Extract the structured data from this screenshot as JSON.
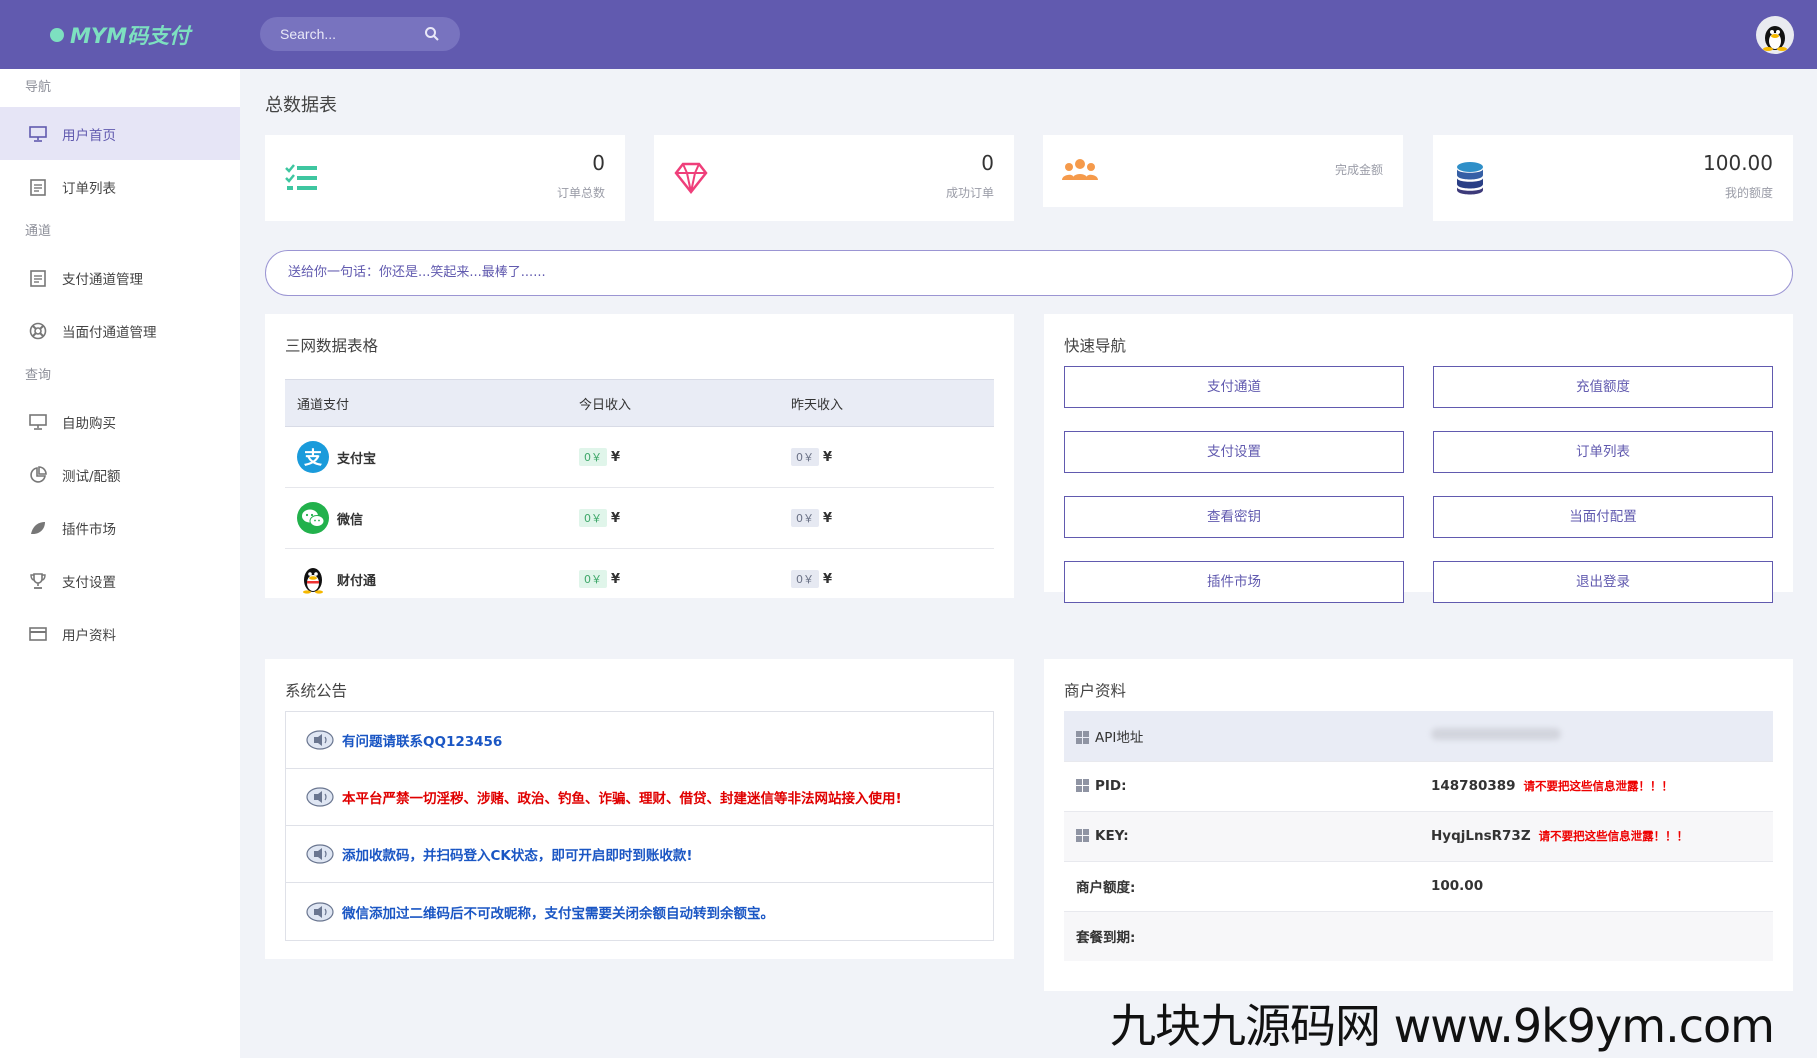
{
  "brand": {
    "name": "MYM码支付"
  },
  "search": {
    "placeholder": "Search..."
  },
  "sidebar": {
    "sections": [
      {
        "title": "导航",
        "items": [
          {
            "label": "用户首页",
            "icon": "monitor-icon"
          },
          {
            "label": "订单列表",
            "icon": "clipboard-icon"
          }
        ]
      },
      {
        "title": "通道",
        "items": [
          {
            "label": "支付通道管理",
            "icon": "clipboard-icon"
          },
          {
            "label": "当面付通道管理",
            "icon": "lifebuoy-icon"
          }
        ]
      },
      {
        "title": "查询",
        "items": [
          {
            "label": "自助购买",
            "icon": "monitor-icon"
          },
          {
            "label": "测试/配额",
            "icon": "pie-chart-icon"
          },
          {
            "label": "插件市场",
            "icon": "leaf-icon"
          },
          {
            "label": "支付设置",
            "icon": "trophy-icon"
          },
          {
            "label": "用户资料",
            "icon": "card-icon"
          }
        ]
      }
    ]
  },
  "page": {
    "title": "总数据表"
  },
  "stats": [
    {
      "value": "0",
      "label": "订单总数",
      "icon": "checklist-icon"
    },
    {
      "value": "0",
      "label": "成功订单",
      "icon": "diamond-icon"
    },
    {
      "value": "",
      "label": "完成金额",
      "icon": "users-icon"
    },
    {
      "value": "100.00",
      "label": "我的额度",
      "icon": "database-icon"
    }
  ],
  "motto": "送给你一句话：你还是...笑起来...最棒了......",
  "network_table": {
    "title": "三网数据表格",
    "headers": [
      "通道支付",
      "今日收入",
      "昨天收入"
    ],
    "rows": [
      {
        "name": "支付宝",
        "today": "0￥",
        "yesterday": "0￥",
        "currency": "¥"
      },
      {
        "name": "微信",
        "today": "0￥",
        "yesterday": "0￥",
        "currency": "¥"
      },
      {
        "name": "财付通",
        "today": "0￥",
        "yesterday": "0￥",
        "currency": "¥"
      }
    ]
  },
  "quick_nav": {
    "title": "快速导航",
    "buttons": [
      "支付通道",
      "充值额度",
      "支付设置",
      "订单列表",
      "查看密钥",
      "当面付配置",
      "插件市场",
      "退出登录"
    ]
  },
  "notices": {
    "title": "系统公告",
    "items": [
      {
        "text": "有问题请联系QQ123456",
        "color": "#1a56c4"
      },
      {
        "text": "本平台严禁一切淫秽、涉赌、政治、钓鱼、诈骗、理财、借贷、封建迷信等非法网站接入使用!",
        "color": "#e00000"
      },
      {
        "text": "添加收款码，并扫码登入CK状态，即可开启即时到账收款!",
        "color": "#1a56c4"
      },
      {
        "text": "微信添加过二维码后不可改昵称，支付宝需要关闭余额自动转到余额宝。",
        "color": "#1a56c4"
      }
    ]
  },
  "merchant": {
    "title": "商户资料",
    "api_label": "API地址",
    "pid_label": "PID:",
    "pid_value": "148780389",
    "key_label": "KEY:",
    "key_value": "HyqjLnsR73Z",
    "warning": "请不要把这些信息泄露！！！",
    "quota_label": "商户额度:",
    "quota_value": "100.00",
    "expire_label": "套餐到期:",
    "expire_value": ""
  },
  "colors": {
    "primary": "#615aaf",
    "accent": "#7de0c0"
  },
  "watermark": "九块九源码网 www.9k9ym.com"
}
